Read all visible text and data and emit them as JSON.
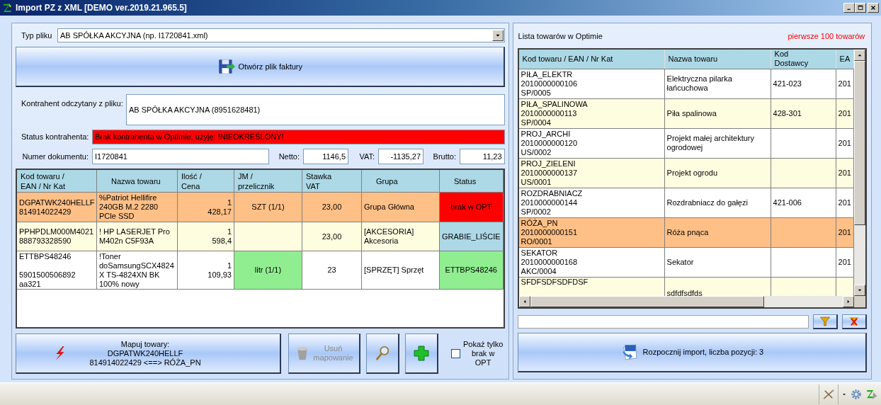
{
  "window": {
    "title": "Import PZ z XML [DEMO ver.2019.21.965.5]"
  },
  "file_type": {
    "label": "Typ pliku",
    "value": "AB SPÓŁKA AKCYJNA (np. I1720841.xml)"
  },
  "open_button": {
    "label": "Otwórz plik faktury"
  },
  "contractor": {
    "label": "Kontrahent odczytany z pliku:",
    "value": "AB SPÓŁKA AKCYJNA (8951628481)"
  },
  "contractor_status": {
    "label": "Status kontrahenta:",
    "value": "Brak kontrahenta w Optimie, użyję: !NIEOKREŚLONY!"
  },
  "document": {
    "number_label": "Numer dokumentu:",
    "number": "I1720841",
    "netto_label": "Netto:",
    "netto": "1146,5",
    "vat_label": "VAT:",
    "vat": "-1135,27",
    "brutto_label": "Brutto:",
    "brutto": "11,23"
  },
  "invoice_table": {
    "columns": [
      "Kod towaru /\nEAN / Nr Kat",
      "Nazwa towaru",
      "Ilość /\nCena",
      "JM /\nprzelicznik",
      "Stawka\nVAT",
      "Grupa",
      "Status"
    ],
    "rows": [
      {
        "color": "#ffc087",
        "code": "DGPATWK240HELLF\n814914022429",
        "name": "%Patriot Hellifire\n240GB M.2 2280\nPCle SSD",
        "qty_price": "1\n428,17",
        "unit": {
          "text": "SZT (1/1)"
        },
        "vat": "23,00",
        "group": "Grupa Główna",
        "status": {
          "text": "brak w OPT",
          "color": "#ff0000"
        }
      },
      {
        "color": "#fffde0",
        "code": "PPHPDLM000M4021\n888793328590",
        "name": "! HP LASERJET Pro\nM402n C5F93A",
        "qty_price": "1\n598,4",
        "unit": {},
        "vat": "23,00",
        "group": "[AKCESORIA]\nAkcesoria",
        "status": {
          "text": "GRABIE_LIŚCIE",
          "color": "#add8e6"
        }
      },
      {
        "color": "#ffffff",
        "code": "ETTBPS48246\n\n5901500506892\naa321",
        "name": "!Toner\ndoSamsungSCX4824\nX TS-4824XN BK\n100% nowy",
        "qty_price": "1\n109,93",
        "unit": {
          "text": "litr (1/1)",
          "color": "#90ee90"
        },
        "vat": "23",
        "group": "[SPRZĘT] Sprzęt",
        "status": {
          "text": "ETTBPS48246",
          "color": "#90ee90"
        }
      }
    ]
  },
  "map_button": {
    "label": "Mapuj towary:\nDGPATWK240HELLF\n814914022429 <==> RÓŻA_PN"
  },
  "remove_mapping_button": {
    "label": "Usuń\nmapowanie",
    "disabled": true
  },
  "show_missing": {
    "label": "Pokaż tylko\nbrak w\nOPT",
    "checked": false
  },
  "products": {
    "title": "Lista towarów w Optimie",
    "note": "pierwsze 100 towarów",
    "columns": [
      "Kod towaru / EAN / Nr Kat",
      "Nazwa towaru",
      "Kod\nDostawcy",
      "EA"
    ],
    "rows": [
      {
        "code": "PIŁA_ELEKTR\n2010000000106\nSP/0005",
        "name": "Elektryczna pilarka\nłańcuchowa",
        "supplier_code": "421-023",
        "ean": "201",
        "selected": false
      },
      {
        "code": "PIŁA_SPALINOWA\n2010000000113\nSP/0004",
        "name": "Piła spalinowa",
        "supplier_code": "428-301",
        "ean": "201",
        "selected": false
      },
      {
        "code": "PROJ_ARCHI\n2010000000120\nUS/0002",
        "name": "Projekt małej architektury\nogrodowej",
        "supplier_code": "",
        "ean": "201",
        "selected": false
      },
      {
        "code": "PROJ_ZIELENI\n2010000000137\nUS/0001",
        "name": "Projekt ogrodu",
        "supplier_code": "",
        "ean": "201",
        "selected": false
      },
      {
        "code": "ROZDRABNIACZ\n2010000000144\nSP/0002",
        "name": "Rozdrabniacz do gałęzi",
        "supplier_code": "421-006",
        "ean": "201",
        "selected": false
      },
      {
        "code": "RÓŻA_PN\n2010000000151\nRO/0001",
        "name": "Róża pnąca",
        "supplier_code": "",
        "ean": "201",
        "selected": true
      },
      {
        "code": "SEKATOR\n2010000000168\nAKC/0004",
        "name": "Sekator",
        "supplier_code": "",
        "ean": "201",
        "selected": false
      },
      {
        "code": "SFDFSDFSDFDSF",
        "name": "sdfdfsdfds",
        "supplier_code": "",
        "ean": "",
        "selected": false
      }
    ]
  },
  "import_button": {
    "label": "Rozpocznij import, liczba pozycji: 3"
  }
}
